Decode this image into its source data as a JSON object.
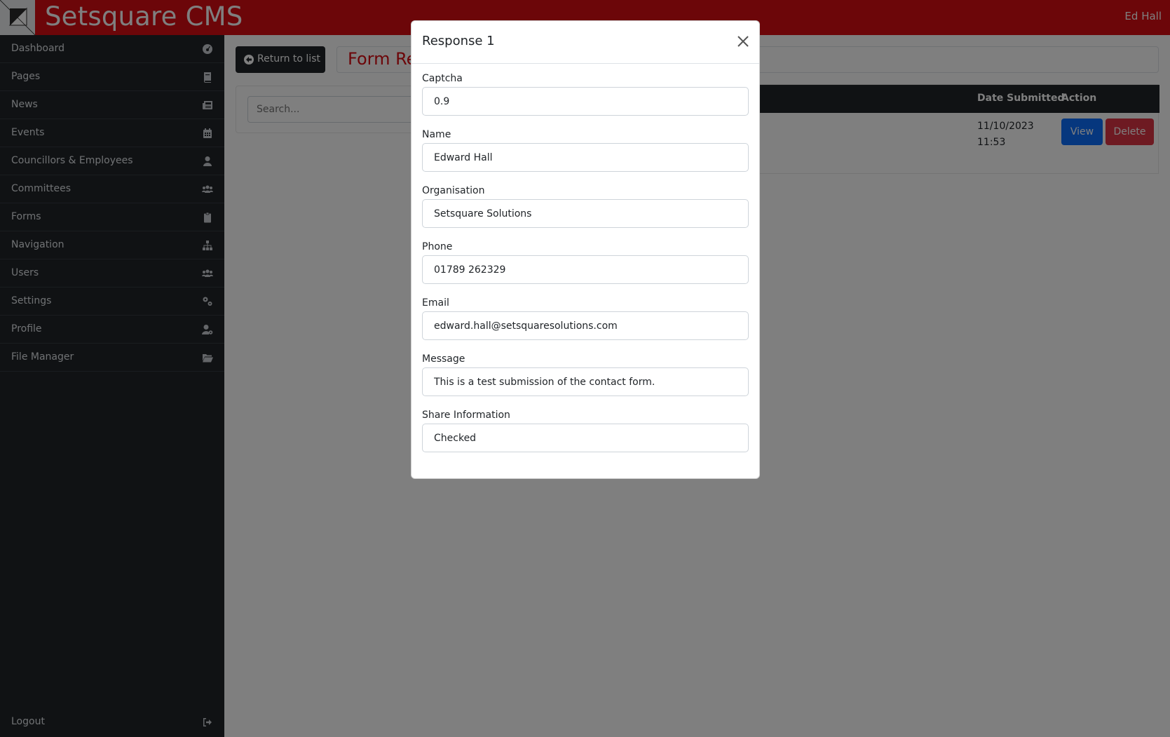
{
  "header": {
    "app_title": "Setsquare CMS",
    "user_name": "Ed Hall"
  },
  "sidebar": {
    "items": [
      {
        "label": "Dashboard",
        "icon": "dashboard-icon"
      },
      {
        "label": "Pages",
        "icon": "book-icon"
      },
      {
        "label": "News",
        "icon": "newspaper-icon"
      },
      {
        "label": "Events",
        "icon": "calendar-icon"
      },
      {
        "label": "Councillors & Employees",
        "icon": "user-icon"
      },
      {
        "label": "Committees",
        "icon": "users-icon"
      },
      {
        "label": "Forms",
        "icon": "clipboard-icon"
      },
      {
        "label": "Navigation",
        "icon": "sitemap-icon"
      },
      {
        "label": "Users",
        "icon": "users-icon"
      },
      {
        "label": "Settings",
        "icon": "gears-icon"
      },
      {
        "label": "Profile",
        "icon": "user-cog-icon"
      },
      {
        "label": "File Manager",
        "icon": "folder-open-icon"
      }
    ],
    "logout_label": "Logout"
  },
  "main": {
    "return_label": "Return to list",
    "page_title": "Form Re",
    "search_placeholder": "Search...",
    "table": {
      "col_date": "Date Submitted",
      "col_action": "Action",
      "rows": [
        {
          "date": "11/10/2023 11:53",
          "view_label": "View",
          "delete_label": "Delete"
        }
      ]
    }
  },
  "modal": {
    "title": "Response 1",
    "fields": [
      {
        "label": "Captcha",
        "value": "0.9"
      },
      {
        "label": "Name",
        "value": "Edward Hall"
      },
      {
        "label": "Organisation",
        "value": "Setsquare Solutions"
      },
      {
        "label": "Phone",
        "value": "01789 262329"
      },
      {
        "label": "Email",
        "value": "edward.hall@setsquaresolutions.com"
      },
      {
        "label": "Message",
        "value": "This is a test submission of the contact form."
      },
      {
        "label": "Share Information",
        "value": "Checked"
      }
    ]
  },
  "colors": {
    "brand_red": "#d90d13",
    "sidebar_bg": "#212529",
    "view_blue": "#0d6efd",
    "delete_red": "#dc3545"
  }
}
